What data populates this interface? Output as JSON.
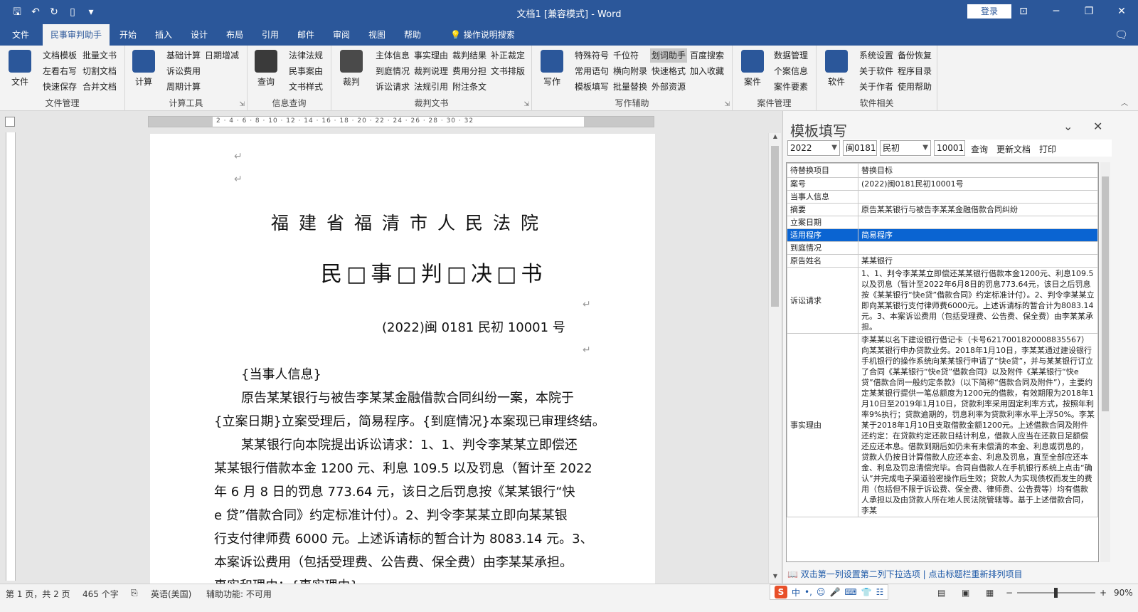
{
  "window": {
    "title": "文档1 [兼容模式] - Word",
    "login_label": "登录"
  },
  "tabs": [
    {
      "label": "文件"
    },
    {
      "label": "民事审判助手"
    },
    {
      "label": "开始"
    },
    {
      "label": "插入"
    },
    {
      "label": "设计"
    },
    {
      "label": "布局"
    },
    {
      "label": "引用"
    },
    {
      "label": "邮件"
    },
    {
      "label": "审阅"
    },
    {
      "label": "视图"
    },
    {
      "label": "帮助"
    }
  ],
  "tell_me": "操作说明搜索",
  "ribbon": {
    "file_mgmt": {
      "label": "文件管理",
      "big": "文件",
      "items": [
        "文档模板",
        "批量文书",
        "左看右写",
        "切割文档",
        "快速保存",
        "合并文档"
      ]
    },
    "calc": {
      "label": "计算工具",
      "big": "计算",
      "items": [
        "基础计算",
        "日期增减",
        "诉讼费用",
        "周期计算"
      ]
    },
    "info": {
      "label": "信息查询",
      "big": "查询",
      "items": [
        "法律法规",
        "民事案由",
        "文书样式"
      ]
    },
    "judge": {
      "label": "裁判文书",
      "big": "裁判",
      "items": [
        "主体信息",
        "事实理由",
        "裁判结果",
        "补正裁定",
        "到庭情况",
        "裁判说理",
        "费用分担",
        "文书排版",
        "诉讼请求",
        "法规引用",
        "附注条文"
      ]
    },
    "write": {
      "label": "写作辅助",
      "big": "写作",
      "items": [
        "特殊符号",
        "千位符",
        "划词助手",
        "百度搜索",
        "常用语句",
        "横向附录",
        "快速格式",
        "加入收藏",
        "模板填写",
        "批量替换",
        "外部资源"
      ]
    },
    "case": {
      "label": "案件管理",
      "big": "案件",
      "items": [
        "数据管理",
        "个案信息",
        "案件要素"
      ]
    },
    "soft": {
      "label": "软件相关",
      "big": "软件",
      "items": [
        "系统设置",
        "备份恢复",
        "关于软件",
        "程序目录",
        "关于作者",
        "使用帮助"
      ]
    }
  },
  "ruler_numbers": "2 · 4 · 6 · 8 · 10 · 12 · 14 · 16 · 18 · 20 · 22 · 24 · 26 · 28 · 30 · 32",
  "document": {
    "court": "福建省福清市人民法院",
    "doc_type": "民□事□判□决□书",
    "case_no": "(2022)闽 0181 民初 10001 号",
    "lines": [
      "{当事人信息}",
      "原告某某银行与被告李某某金融借款合同纠纷一案，本院于",
      "{立案日期}立案受理后，简易程序。{到庭情况}本案现已审理终结。",
      "某某银行向本院提出诉讼请求：1、1、判令李某某立即偿还",
      "某某银行借款本金 1200 元、利息 109.5 以及罚息（暂计至 2022",
      "年 6 月 8 日的罚息 773.64 元，该日之后罚息按《某某银行“快",
      "e 贷”借款合同》约定标准计付）。2、判令李某某立即向某某银",
      "行支付律师费 6000 元。上述诉请标的暂合计为 8083.14 元。3、",
      "本案诉讼费用（包括受理费、公告费、保全费）由李某某承担。",
      "事实和理由：{事实理由}"
    ]
  },
  "pane": {
    "title": "模板填写",
    "toolbar": {
      "year": "2022",
      "court_code": "闽0181",
      "case_type": "民初",
      "case_num": "10001",
      "query": "查询",
      "update": "更新文档",
      "print": "打印"
    },
    "columns": [
      "待替换项目",
      "替换目标"
    ],
    "rows": [
      {
        "key": "案号",
        "val": "(2022)闽0181民初10001号"
      },
      {
        "key": "当事人信息",
        "val": ""
      },
      {
        "key": "摘要",
        "val": "原告某某银行与被告李某某金融借款合同纠纷"
      },
      {
        "key": "立案日期",
        "val": ""
      },
      {
        "key": "适用程序",
        "val": "简易程序",
        "selected": true
      },
      {
        "key": "到庭情况",
        "val": ""
      },
      {
        "key": "原告姓名",
        "val": "某某银行"
      },
      {
        "key": "诉讼请求",
        "val": "1、1、判令李某某立即偿还某某银行借款本金1200元、利息109.5以及罚息（暂计至2022年6月8日的罚息773.64元，该日之后罚息按《某某银行“快e贷”借款合同》约定标准计付）。2、判令李某某立即向某某银行支付律师费6000元。上述诉请标的暂合计为8083.14元。3、本案诉讼费用（包括受理费、公告费、保全费）由李某某承担。"
      },
      {
        "key": "事实理由",
        "val": "李某某以名下建设银行借记卡（卡号6217001820008835567）向某某银行申办贷款业务。2018年1月10日，李某某通过建设银行手机银行的操作系统向某某银行申请了“快e贷”，并与某某银行订立了合同《某某银行“快e贷”借款合同》以及附件《某某银行“快e贷”借款合同一般约定条款》（以下简称“借款合同及附件”），主要约定某某银行提供一笔总额度为1200元的借款，有效期限为2018年1月10日至2019年1月10日，贷款利率采用固定利率方式，按照年利率9%执行；贷款逾期的，罚息利率为贷款利率水平上浮50%。李某某于2018年1月10日支取借款金额1200元。上述借款合同及附件还约定：在贷款约定还款日结计利息，借款人应当在还款日足额偿还应还本息。借款到期后如仍未有未偿清的本金、利息或罚息的，贷款人仍按日计算借款人应还本金、利息及罚息，直至全部应还本金、利息及罚息清偿完毕。合同自借款人在手机银行系统上点击“确认”并完成电子渠道验密操作后生效；贷款人为实现债权而发生的费用（包括但不限于诉讼费、保全费、律师费、公告费等）均有借款人承担以及由贷款人所在地人民法院管辖等。基于上述借款合同，李某"
      }
    ],
    "hint": "双击第一列设置第二列下拉选项 | 点击标题栏重新排列项目"
  },
  "status": {
    "page": "第 1 页，共 2 页",
    "words": "465 个字",
    "lang": "英语(美国)",
    "access": "辅助功能: 不可用",
    "zoom": "90%"
  },
  "ime": {
    "lang": "中"
  }
}
